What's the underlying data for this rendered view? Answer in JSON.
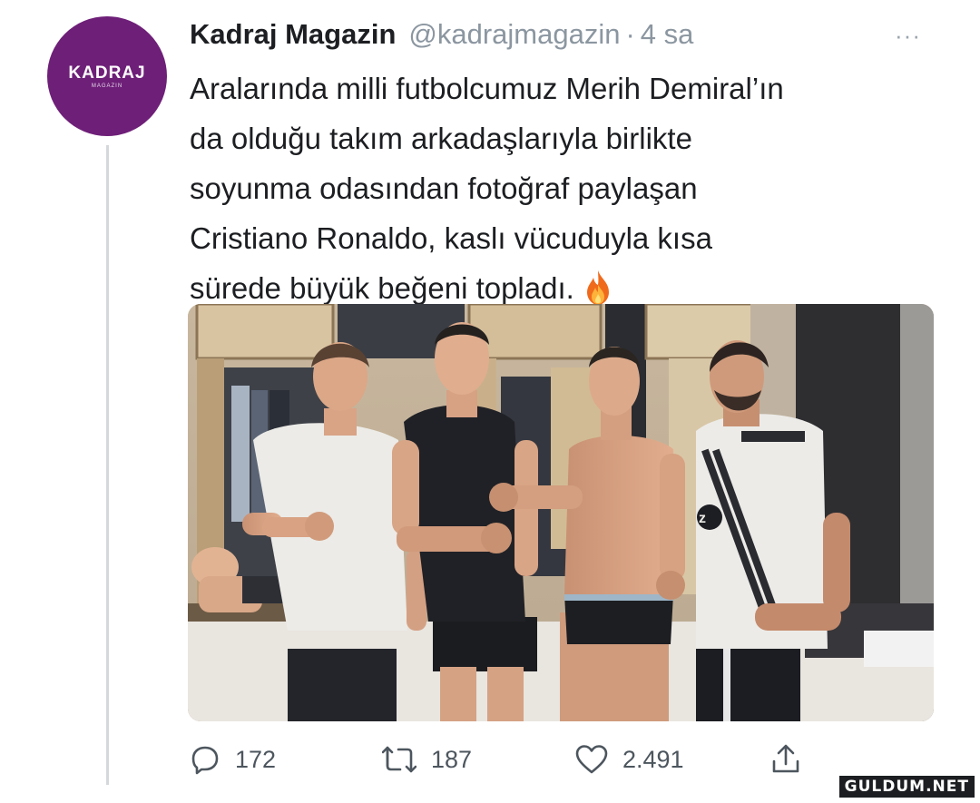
{
  "account": {
    "avatar_brand": "KADRAJ",
    "avatar_sub": "MAGAZIN",
    "name": "Kadraj Magazin",
    "handle": "@kadrajmagazin",
    "separator": "·",
    "time": "4 sa",
    "more_label": "···"
  },
  "tweet": {
    "lines": [
      "Aralarında milli futbolcumuz Merih Demiral’ın",
      "da olduğu takım arkadaşlarıyla birlikte",
      "soyunma odasından fotoğraf paylaşan",
      "Cristiano Ronaldo, kaslı vücuduyla kısa",
      "sürede büyük beğeni topladı."
    ],
    "emoji_icon": "fire-icon",
    "media": {
      "photo_shirt_logo": "z",
      "subjects": [
        "player-white-shirt",
        "player-black-shirt",
        "player-shirtless",
        "player-training-kit"
      ]
    }
  },
  "actions": {
    "reply": {
      "icon": "reply-icon",
      "count": "172"
    },
    "retweet": {
      "icon": "retweet-icon",
      "count": "187"
    },
    "like": {
      "icon": "heart-icon",
      "count": "2.491"
    },
    "share": {
      "icon": "share-icon"
    }
  },
  "watermark": "GULDUM.NET",
  "colors": {
    "avatar_bg": "#6e1f78",
    "text": "#1c1e21",
    "muted": "#8b96a0",
    "thread_line": "#d4d8db"
  }
}
